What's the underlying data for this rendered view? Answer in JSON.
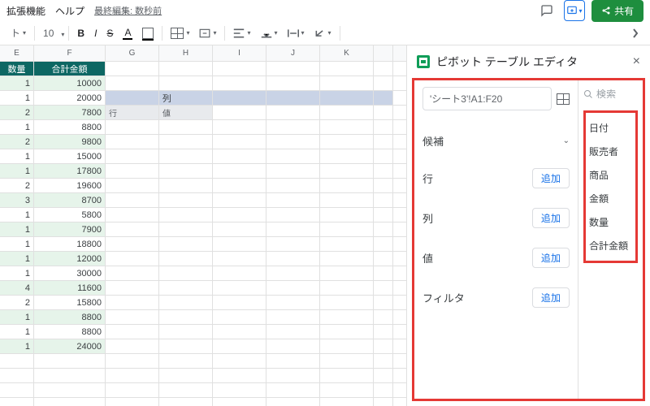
{
  "menu": {
    "ext": "拡張機能",
    "help": "ヘルプ"
  },
  "lastedit": "最終編集: 数秒前",
  "share": "共有",
  "toolbar": {
    "fontsize": "10",
    "bold": "B",
    "italic": "I",
    "strike": "S",
    "textcolor": "A"
  },
  "cols": [
    "E",
    "F",
    "G",
    "H",
    "I",
    "J",
    "K"
  ],
  "hdr": {
    "qty": "数量",
    "total": "合計金額"
  },
  "rows": [
    {
      "q": "1",
      "a": "10000"
    },
    {
      "q": "1",
      "a": "20000"
    },
    {
      "q": "2",
      "a": "7800"
    },
    {
      "q": "1",
      "a": "8800"
    },
    {
      "q": "2",
      "a": "9800"
    },
    {
      "q": "1",
      "a": "15000"
    },
    {
      "q": "1",
      "a": "17800"
    },
    {
      "q": "2",
      "a": "19600"
    },
    {
      "q": "3",
      "a": "8700"
    },
    {
      "q": "1",
      "a": "5800"
    },
    {
      "q": "1",
      "a": "7900"
    },
    {
      "q": "1",
      "a": "18800"
    },
    {
      "q": "1",
      "a": "12000"
    },
    {
      "q": "1",
      "a": "30000"
    },
    {
      "q": "4",
      "a": "11600"
    },
    {
      "q": "2",
      "a": "15800"
    },
    {
      "q": "1",
      "a": "8800"
    },
    {
      "q": "1",
      "a": "8800"
    },
    {
      "q": "1",
      "a": "24000"
    }
  ],
  "pivot": {
    "rowlbl": "行",
    "collbl": "列",
    "vallbl": "値"
  },
  "panel": {
    "title": "ピボット テーブル エディタ",
    "range": "'シート3'!A1:F20",
    "suggest": "候補",
    "row": "行",
    "col": "列",
    "val": "値",
    "filter": "フィルタ",
    "add": "追加",
    "search": "検索"
  },
  "fields": [
    "日付",
    "販売者",
    "商品",
    "金額",
    "数量",
    "合計金額"
  ]
}
